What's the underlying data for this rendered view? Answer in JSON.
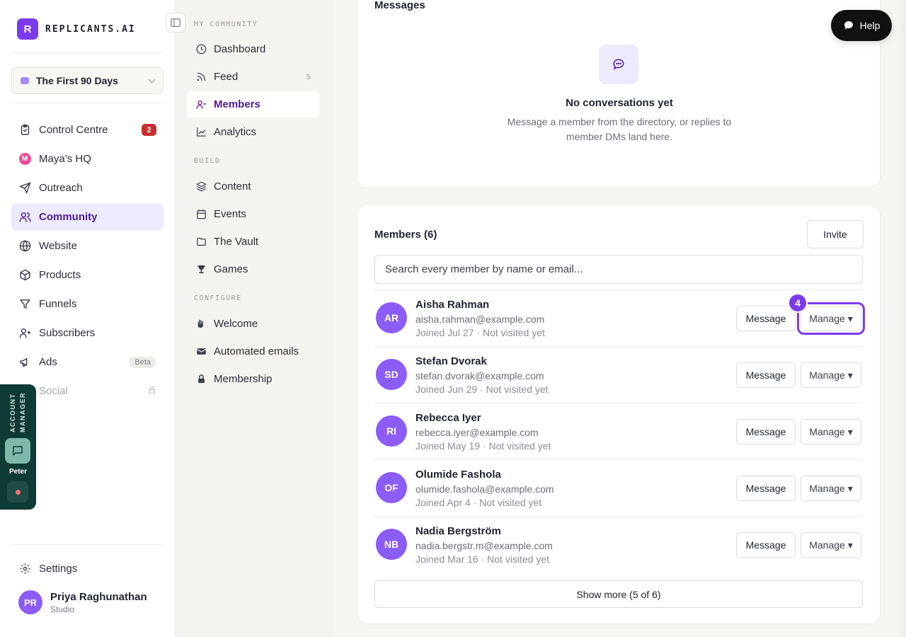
{
  "brand": {
    "logo_letter": "R",
    "name": "REPLICANTS.AI"
  },
  "workspace": {
    "name": "The First 90 Days"
  },
  "nav": {
    "items": [
      {
        "label": "Control Centre",
        "badge": "2",
        "icon": "clipboard-icon"
      },
      {
        "label": "Maya’s HQ",
        "icon": "maya-icon",
        "icon_letter": "M"
      },
      {
        "label": "Outreach",
        "icon": "send-icon"
      },
      {
        "label": "Community",
        "icon": "users-icon",
        "active": true
      },
      {
        "label": "Website",
        "icon": "globe-icon"
      },
      {
        "label": "Products",
        "icon": "box-icon"
      },
      {
        "label": "Funnels",
        "icon": "funnel-icon"
      },
      {
        "label": "Subscribers",
        "icon": "subscribers-icon"
      },
      {
        "label": "Ads",
        "badge": "Beta",
        "icon": "megaphone-icon"
      },
      {
        "label": "Social",
        "icon": "share-icon",
        "locked": true
      }
    ],
    "settings": "Settings"
  },
  "user": {
    "initials": "PR",
    "name": "Priya Raghunathan",
    "plan": "Studio"
  },
  "account_manager": {
    "label": "ACCOUNT MANAGER",
    "name": "Peter"
  },
  "subnav": {
    "section_community": "MY COMMUNITY",
    "section_build": "BUILD",
    "section_configure": "CONFIGURE",
    "dashboard": "Dashboard",
    "feed": "Feed",
    "feed_count": "5",
    "members": "Members",
    "analytics": "Analytics",
    "content": "Content",
    "events": "Events",
    "vault": "The Vault",
    "games": "Games",
    "welcome": "Welcome",
    "automated_emails": "Automated emails",
    "membership": "Membership"
  },
  "messages": {
    "title": "Messages",
    "empty_title": "No conversations yet",
    "empty_sub": "Message a member from the directory, or replies to member DMs land here."
  },
  "help": {
    "label": "Help"
  },
  "members": {
    "title": "Members (6)",
    "invite": "Invite",
    "search_placeholder": "Search every member by name or email...",
    "message_label": "Message",
    "manage_label": "Manage ▾",
    "step_badge": "4",
    "show_more": "Show more (5 of 6)",
    "rows": [
      {
        "initials": "AR",
        "name": "Aisha Rahman",
        "email": "aisha.rahman@example.com",
        "meta": "Joined Jul 27 · Not visited yet"
      },
      {
        "initials": "SD",
        "name": "Stefan Dvorak",
        "email": "stefan.dvorak@example.com",
        "meta": "Joined Jun 29 · Not visited yet"
      },
      {
        "initials": "RI",
        "name": "Rebecca Iyer",
        "email": "rebecca.iyer@example.com",
        "meta": "Joined May 19 · Not visited yet"
      },
      {
        "initials": "OF",
        "name": "Olumide Fashola",
        "email": "olumide.fashola@example.com",
        "meta": "Joined Apr 4 · Not visited yet"
      },
      {
        "initials": "NB",
        "name": "Nadia Bergström",
        "email": "nadia.bergstr.m@example.com",
        "meta": "Joined Mar 16 · Not visited yet"
      }
    ]
  },
  "colors": {
    "accent": "#7c3aed",
    "accent_light": "#ede9fe",
    "badge_red": "#c53030",
    "account_manager_bg": "#0f3b36"
  }
}
